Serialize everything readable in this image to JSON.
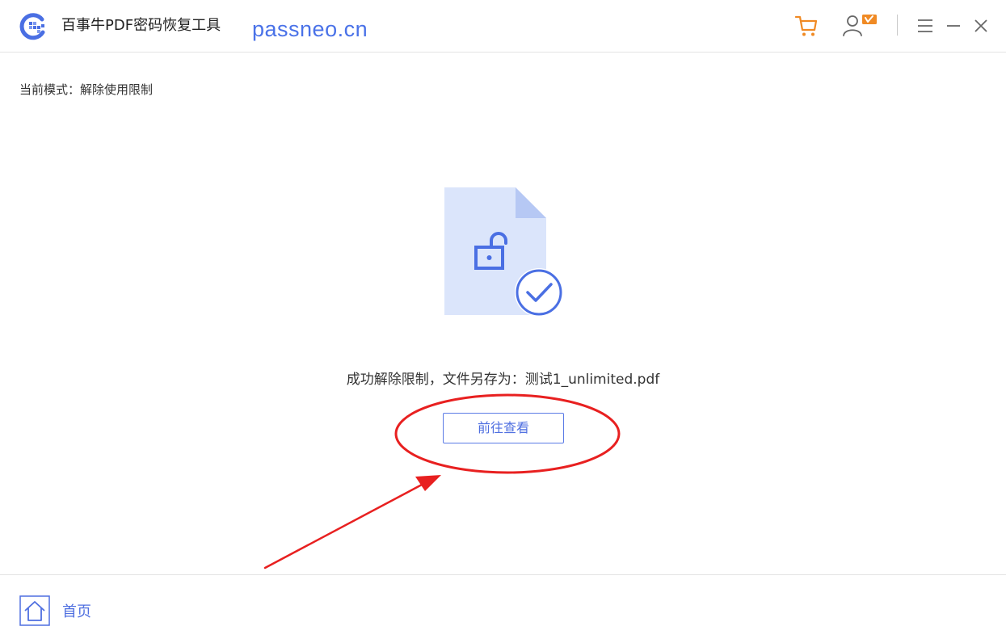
{
  "titlebar": {
    "app_title": "百事牛PDF密码恢复工具",
    "watermark": "passneo.cn",
    "icons": {
      "logo": "app-logo-icon",
      "cart": "cart-icon",
      "user": "user-vip-icon",
      "menu": "menu-icon",
      "minimize": "minimize-icon",
      "close": "close-icon"
    }
  },
  "main": {
    "mode_label": "当前模式：解除使用限制",
    "illustration_icon": "unlocked-document-check-icon",
    "result_message": "成功解除限制，文件另存为：测试1_unlimited.pdf",
    "view_button_label": "前往查看"
  },
  "bottombar": {
    "home_label": "首页",
    "home_icon": "home-icon"
  },
  "colors": {
    "accent": "#4f6fe0",
    "cart": "#f08a24",
    "annotation": "#e82020",
    "doc_fill": "#dbe5fb",
    "doc_fold": "#b6c8f4"
  }
}
